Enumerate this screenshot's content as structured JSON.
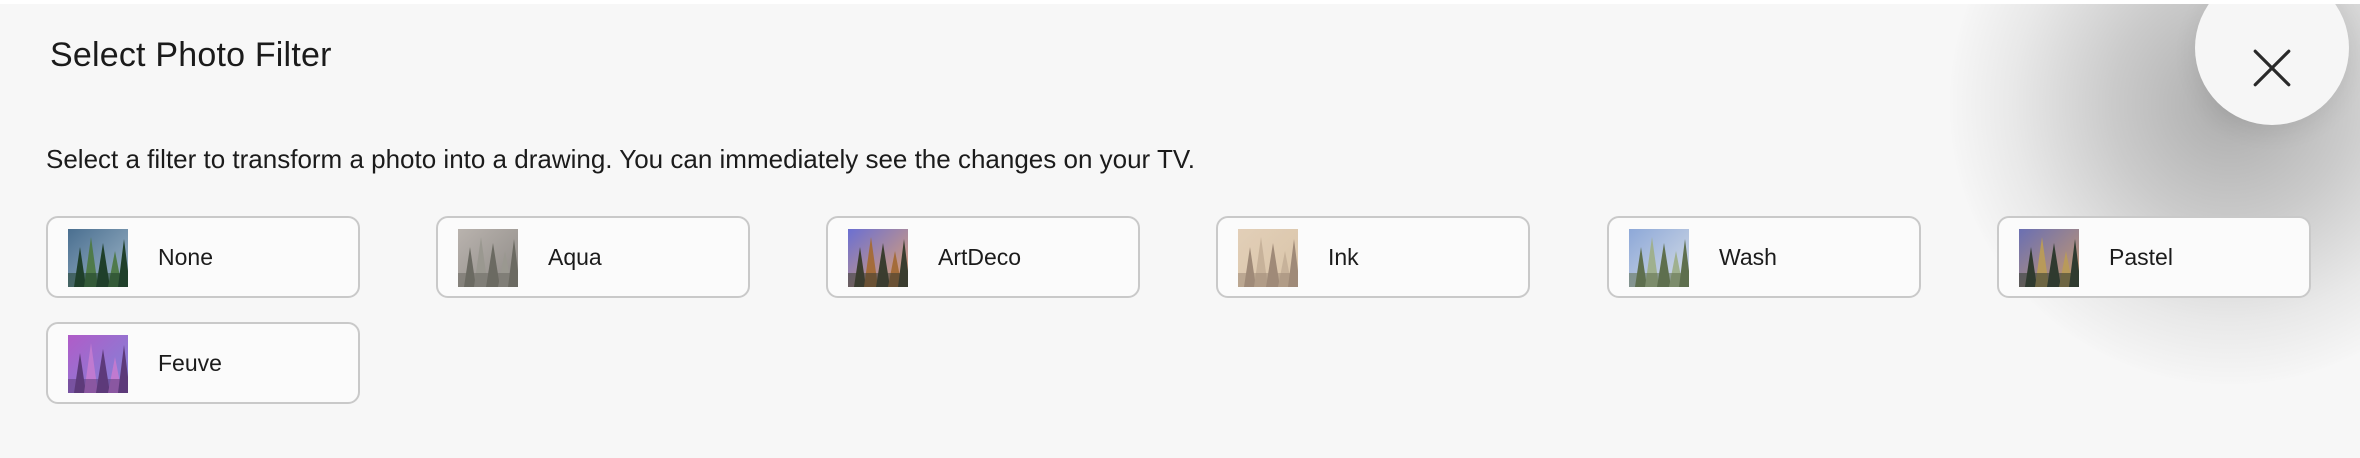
{
  "dialog": {
    "title": "Select Photo Filter",
    "description": "Select a filter to transform a photo into a drawing. You can immediately see the changes on your TV.",
    "close_icon": "close-icon"
  },
  "filters": [
    {
      "label": "None",
      "sky": "#4a6f90",
      "sky2": "#9fb6c8",
      "tree": "#1f3f2a",
      "tree2": "#4f7a4a"
    },
    {
      "label": "Aqua",
      "sky": "#b9b3ae",
      "sky2": "#8e8a86",
      "tree": "#6b6a62",
      "tree2": "#9a9890"
    },
    {
      "label": "ArtDeco",
      "sky": "#6b6fd2",
      "sky2": "#e2a36f",
      "tree": "#3a3d2f",
      "tree2": "#a46c3a"
    },
    {
      "label": "Ink",
      "sky": "#e2cfb8",
      "sky2": "#d9c4a8",
      "tree": "#9f8a78",
      "tree2": "#c7b29a"
    },
    {
      "label": "Wash",
      "sky": "#8da8d8",
      "sky2": "#d6dde6",
      "tree": "#5e6f4e",
      "tree2": "#9fb08f"
    },
    {
      "label": "Pastel",
      "sky": "#6a6fb3",
      "sky2": "#c99a6a",
      "tree": "#2f3a2f",
      "tree2": "#b89a5a"
    },
    {
      "label": "Feuve",
      "sky": "#b05cc8",
      "sky2": "#7f86d8",
      "tree": "#5d3a7a",
      "tree2": "#c07ad0"
    }
  ]
}
